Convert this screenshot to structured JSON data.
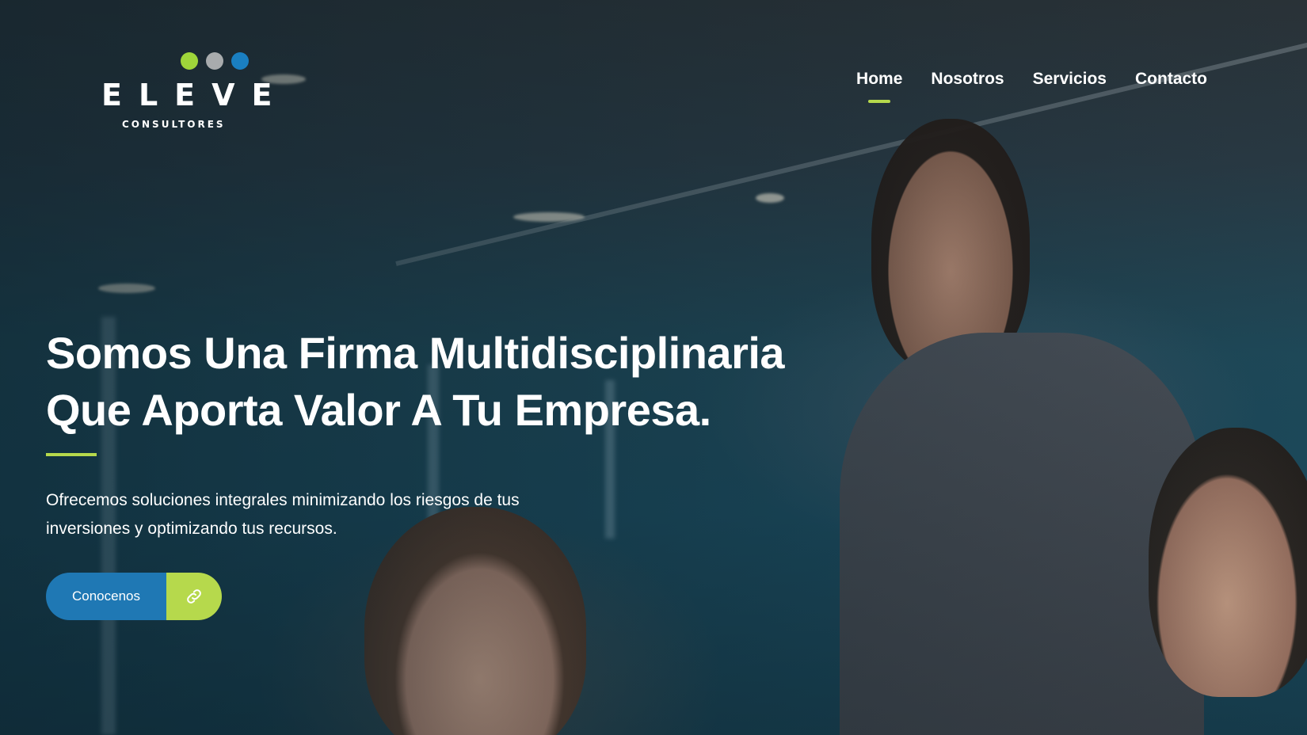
{
  "brand": {
    "name": "ELEVE",
    "tagline": "CONSULTORES",
    "dot_colors": [
      "#9fd53a",
      "#a8abad",
      "#1a7fc1"
    ]
  },
  "nav": {
    "items": [
      {
        "label": "Home",
        "active": true
      },
      {
        "label": "Nosotros",
        "active": false
      },
      {
        "label": "Servicios",
        "active": false
      },
      {
        "label": "Contacto",
        "active": false
      }
    ]
  },
  "hero": {
    "title_line1": "Somos Una Firma Multidisciplinaria",
    "title_line2": "Que Aporta Valor A Tu Empresa.",
    "desc_line1": "Ofrecemos soluciones integrales minimizando los riesgos de tus",
    "desc_line2": "inversiones y optimizando tus recursos.",
    "cta_label": "Conocenos",
    "cta_icon": "link-icon"
  },
  "colors": {
    "accent_green": "#b6d94c",
    "accent_blue": "#1f78b4",
    "text": "#ffffff"
  }
}
